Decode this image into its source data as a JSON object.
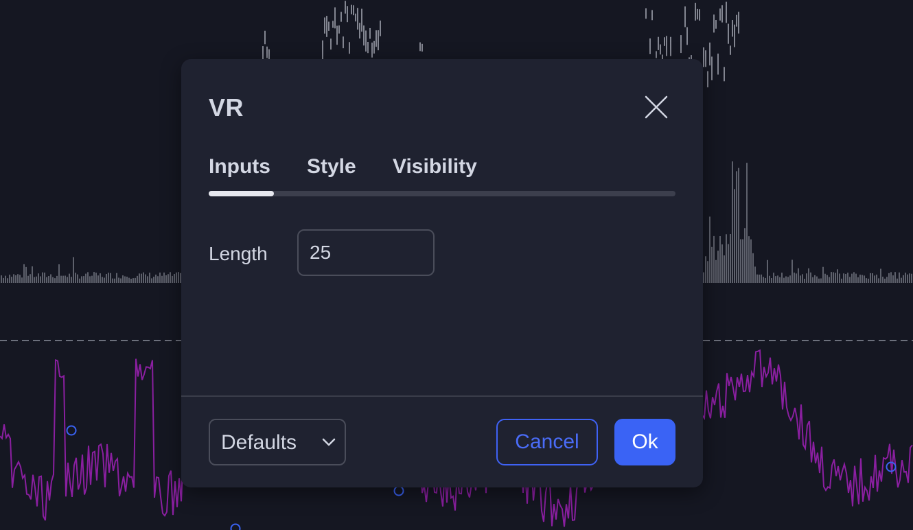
{
  "dialog": {
    "title": "VR",
    "close_icon": "close-icon",
    "tabs": [
      {
        "label": "Inputs",
        "active": true
      },
      {
        "label": "Style",
        "active": false
      },
      {
        "label": "Visibility",
        "active": false
      }
    ],
    "inputs": {
      "length": {
        "label": "Length",
        "value": "25"
      }
    },
    "footer": {
      "defaults_label": "Defaults",
      "defaults_icon": "chevron-down-icon",
      "cancel_label": "Cancel",
      "ok_label": "Ok"
    }
  },
  "colors": {
    "background": "#151722",
    "dialog_bg": "#1f2230",
    "text": "#d3d7e3",
    "accent": "#3a63f5",
    "oscillator_line": "#8a1fa0",
    "marker": "#3a63f5",
    "bars": "#a8abb6"
  }
}
